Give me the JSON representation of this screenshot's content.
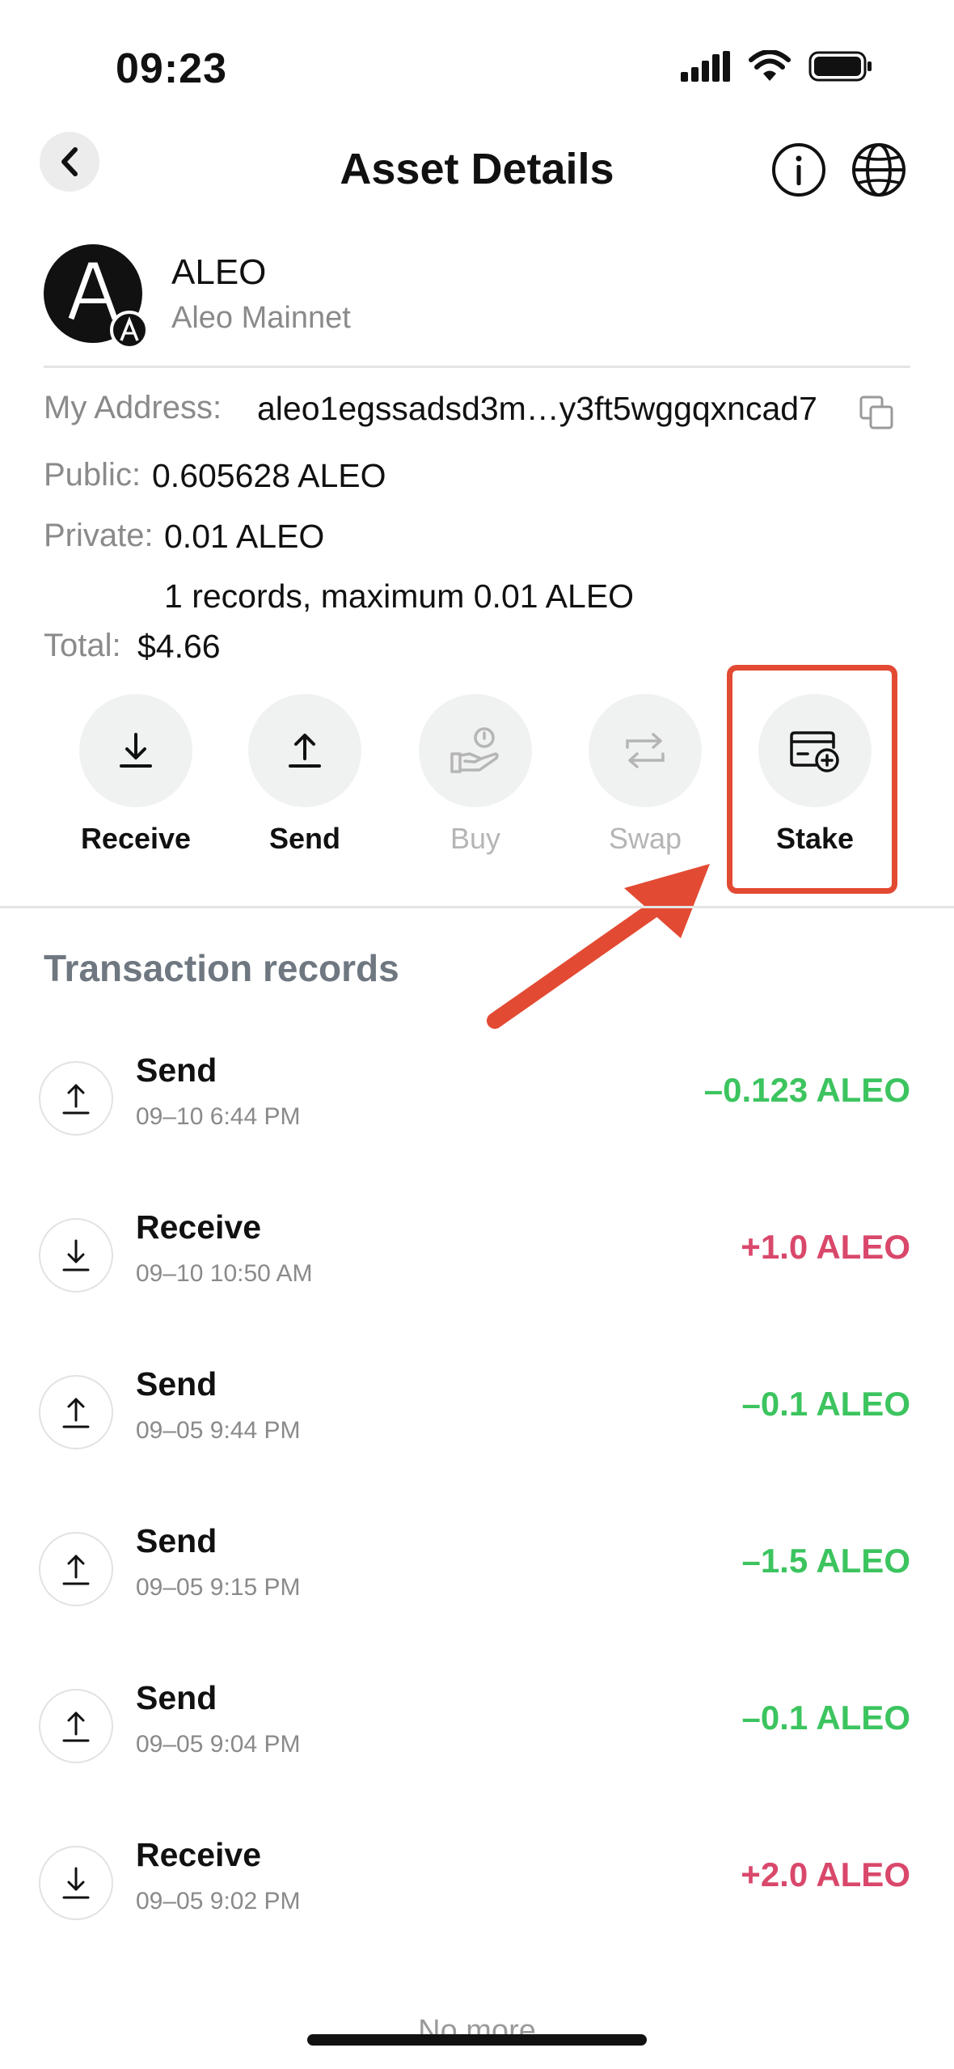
{
  "status_bar": {
    "time": "09:23"
  },
  "header": {
    "title": "Asset Details"
  },
  "token": {
    "name": "ALEO",
    "network": "Aleo Mainnet",
    "logo_letter": "A"
  },
  "details": {
    "address_label": "My Address:",
    "address_value": "aleo1egssadsd3m…y3ft5wggqxncad7",
    "public_label": "Public:",
    "public_value": "0.605628 ALEO",
    "private_label": "Private:",
    "private_value": "0.01 ALEO",
    "records_note": "1 records, maximum 0.01 ALEO",
    "total_label": "Total:",
    "total_value": "$4.66"
  },
  "actions": [
    {
      "label": "Receive",
      "icon": "download-icon",
      "enabled": true
    },
    {
      "label": "Send",
      "icon": "upload-icon",
      "enabled": true
    },
    {
      "label": "Buy",
      "icon": "buy-hand-icon",
      "enabled": false
    },
    {
      "label": "Swap",
      "icon": "swap-icon",
      "enabled": false
    },
    {
      "label": "Stake",
      "icon": "stake-card-icon",
      "enabled": true,
      "highlighted": true
    }
  ],
  "transactions": {
    "title": "Transaction records",
    "items": [
      {
        "type": "Send",
        "time": "09–10 6:44 PM",
        "amount": "–0.123 ALEO",
        "direction": "out"
      },
      {
        "type": "Receive",
        "time": "09–10 10:50 AM",
        "amount": "+1.0 ALEO",
        "direction": "in"
      },
      {
        "type": "Send",
        "time": "09–05 9:44 PM",
        "amount": "–0.1 ALEO",
        "direction": "out"
      },
      {
        "type": "Send",
        "time": "09–05 9:15 PM",
        "amount": "–1.5 ALEO",
        "direction": "out"
      },
      {
        "type": "Send",
        "time": "09–05 9:04 PM",
        "amount": "–0.1 ALEO",
        "direction": "out"
      },
      {
        "type": "Receive",
        "time": "09–05 9:02 PM",
        "amount": "+2.0 ALEO",
        "direction": "in"
      }
    ],
    "footer": "No more"
  },
  "colors": {
    "negative": "#3cc45f",
    "positive": "#d9486b",
    "highlight": "#e34a33"
  }
}
